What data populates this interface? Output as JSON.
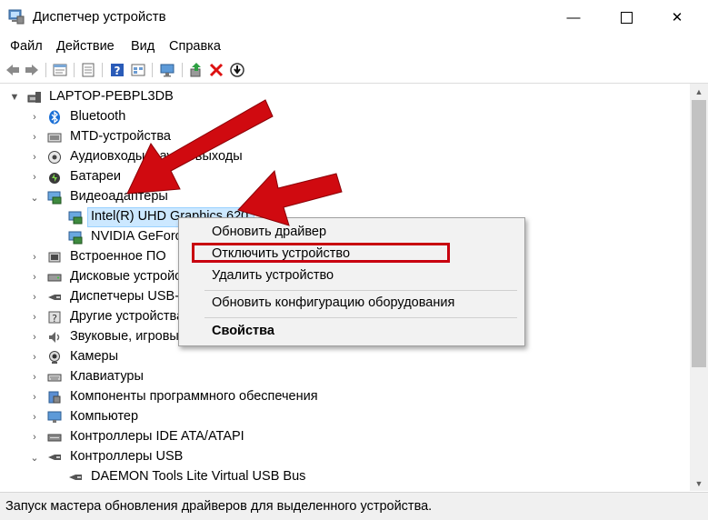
{
  "window": {
    "title": "Диспетчер устройств",
    "minimize_glyph": "—",
    "close_glyph": "✕"
  },
  "menu": [
    "Файл",
    "Действие",
    "Вид",
    "Справка"
  ],
  "toolbar_icons": [
    "back-icon",
    "forward-icon",
    "properties-icon",
    "list-icon",
    "help-icon",
    "view-icon",
    "monitor-icon",
    "update-driver-icon",
    "uninstall-icon",
    "download-icon"
  ],
  "tree": {
    "root": "LAPTOP-PEBPL3DB",
    "items": [
      {
        "label": "Bluetooth",
        "icon": "bluetooth-icon"
      },
      {
        "label": "MTD-устройства",
        "icon": "mtd-icon"
      },
      {
        "label": "Аудиовходы и аудиовыходы",
        "icon": "audio-icon"
      },
      {
        "label": "Батареи",
        "icon": "battery-icon"
      },
      {
        "label": "Видеоадаптеры",
        "icon": "display-adapter-icon"
      },
      {
        "label": "Intel(R) UHD Graphics 620",
        "icon": "gpu-icon"
      },
      {
        "label": "NVIDIA GeForce MX150",
        "icon": "gpu-icon"
      },
      {
        "label": "Встроенное ПО",
        "icon": "firmware-icon"
      },
      {
        "label": "Дисковые устройства",
        "icon": "disk-icon"
      },
      {
        "label": "Диспетчеры USB-устройств",
        "icon": "usb-icon"
      },
      {
        "label": "Другие устройства",
        "icon": "other-devices-icon"
      },
      {
        "label": "Звуковые, игровые и видеоустройства",
        "icon": "sound-icon"
      },
      {
        "label": "Камеры",
        "icon": "camera-icon"
      },
      {
        "label": "Клавиатуры",
        "icon": "keyboard-icon"
      },
      {
        "label": "Компоненты программного обеспечения",
        "icon": "software-icon"
      },
      {
        "label": "Компьютер",
        "icon": "computer-icon"
      },
      {
        "label": "Контроллеры IDE ATA/ATAPI",
        "icon": "ide-icon"
      },
      {
        "label": "Контроллеры USB",
        "icon": "usb-controller-icon"
      },
      {
        "label": "DAEMON Tools Lite Virtual USB Bus",
        "icon": "usb-bus-icon"
      }
    ]
  },
  "context_menu": {
    "update_driver": "Обновить драйвер",
    "disable_device": "Отключить устройство",
    "uninstall_device": "Удалить устройство",
    "scan_hardware": "Обновить конфигурацию оборудования",
    "properties": "Свойства"
  },
  "status": "Запуск мастера обновления драйверов для выделенного устройства.",
  "colors": {
    "accent_red": "#c8000f",
    "selection": "#cce8ff"
  }
}
